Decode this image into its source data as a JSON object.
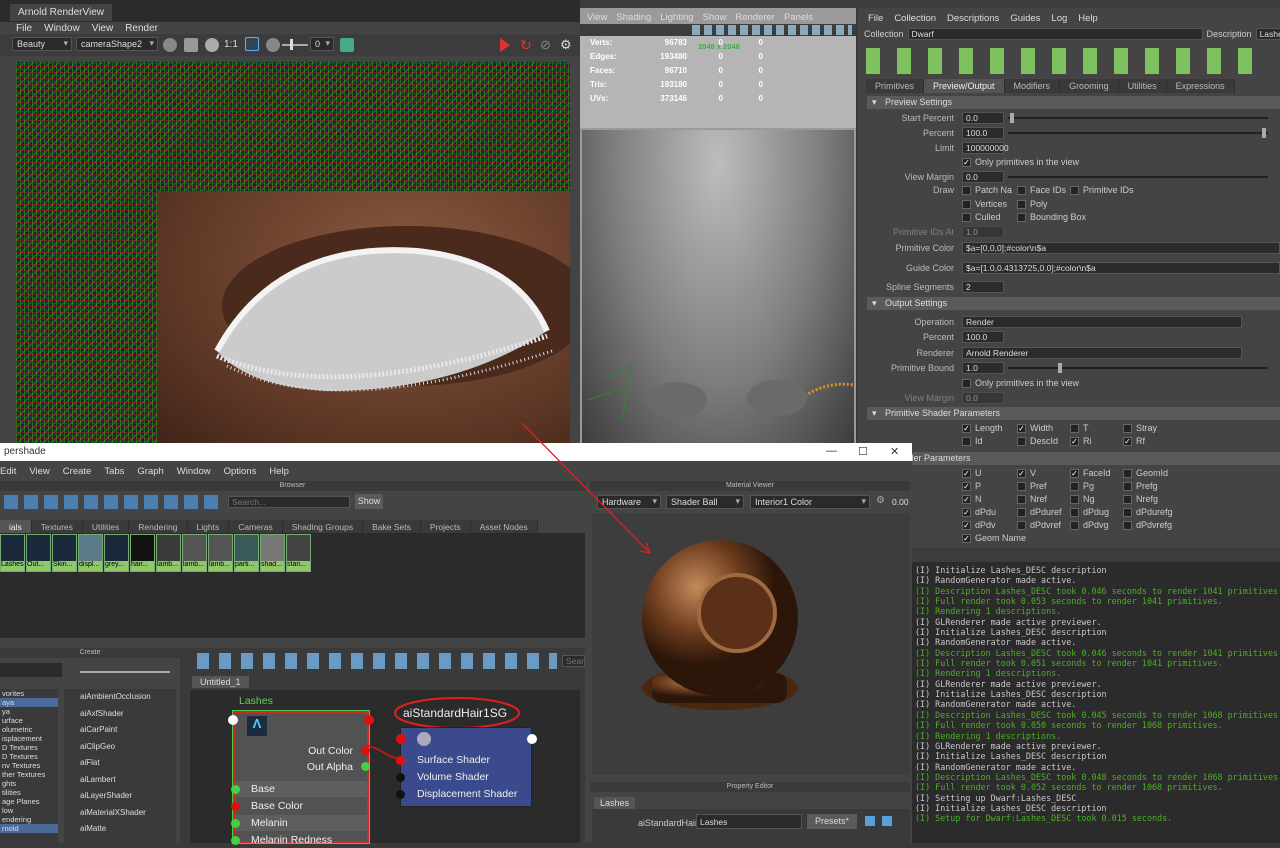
{
  "render_view": {
    "title": "Arnold RenderView",
    "menu": [
      "File",
      "Window",
      "View",
      "Render"
    ],
    "aov": "Beauty",
    "camera": "cameraShape2",
    "ratio": "1:1",
    "exposure": "0"
  },
  "viewport": {
    "menu": [
      "View",
      "Shading",
      "Lighting",
      "Show",
      "Renderer",
      "Panels"
    ],
    "hud": [
      {
        "label": "Verts:",
        "a": "96783",
        "b": "0",
        "c": "0"
      },
      {
        "label": "Edges:",
        "a": "193480",
        "b": "0",
        "c": "0"
      },
      {
        "label": "Faces:",
        "a": "96710",
        "b": "0",
        "c": "0"
      },
      {
        "label": "Tris:",
        "a": "193180",
        "b": "0",
        "c": "0"
      },
      {
        "label": "UVs:",
        "a": "373146",
        "b": "0",
        "c": "0"
      }
    ],
    "resolution": "2048 x 2048"
  },
  "xgen": {
    "menu": [
      "File",
      "Collection",
      "Descriptions",
      "Guides",
      "Log",
      "Help"
    ],
    "collection_label": "Collection",
    "collection": "Dwarf",
    "description_label": "Description",
    "description": "Lashes_DE",
    "tabs": [
      "Primitives",
      "Preview/Output",
      "Modifiers",
      "Grooming",
      "Utilities",
      "Expressions"
    ],
    "preview_header": "Preview Settings",
    "start_percent_label": "Start Percent",
    "start_percent": "0.0",
    "percent_label": "Percent",
    "percent": "100.0",
    "limit_label": "Limit",
    "limit": "100000000",
    "only_visible": "Only primitives in the view",
    "view_margin_label": "View Margin",
    "view_margin": "0.0",
    "draw_label": "Draw",
    "draw_opts": [
      "Patch Na",
      "Face IDs",
      "Primitive IDs",
      "Vertices",
      "Poly",
      "Culled",
      "Bounding Box"
    ],
    "prim_ids_at_label": "Primitive IDs At",
    "prim_ids_at": "1.0",
    "prim_color_label": "Primitive Color",
    "prim_color": "$a=[0,0,0];#color\\n$a",
    "guide_color_label": "Guide Color",
    "guide_color": "$a=[1.0,0.4313725,0.0];#color\\n$a",
    "spline_label": "Spline Segments",
    "spline": "2",
    "output_header": "Output Settings",
    "operation_label": "Operation",
    "operation": "Render",
    "out_percent_label": "Percent",
    "out_percent": "100.0",
    "renderer_label": "Renderer",
    "renderer": "Arnold Renderer",
    "prim_bound_label": "Primitive Bound",
    "prim_bound": "1.0",
    "out_only_visible": "Only primitives in the view",
    "out_view_margin_label": "View Margin",
    "out_view_margin": "0.0",
    "prim_shader_header": "Primitive Shader Parameters",
    "prim_shader": [
      "Length",
      "Width",
      "T",
      "Stray",
      "Id",
      "DescId",
      "Ri",
      "Rf"
    ],
    "shader_header": "e Shader Parameters",
    "shader_params": [
      "U",
      "V",
      "FaceId",
      "GeomId",
      "P",
      "Pref",
      "Pg",
      "Prefg",
      "N",
      "Nref",
      "Ng",
      "Nrefg",
      "dPdu",
      "dPduref",
      "dPdug",
      "dPdurefg",
      "dPdv",
      "dPdvref",
      "dPdvg",
      "dPdvrefg",
      "Geom Name"
    ]
  },
  "log": [
    {
      "t": "(I) Initialize Lashes_DESC description",
      "g": false
    },
    {
      "t": "(I) RandomGenerator made active.",
      "g": false
    },
    {
      "t": "(I) Description Lashes_DESC took 0.046 seconds to render 1041 primitives.",
      "g": true
    },
    {
      "t": "(I) Full render took 0.053 seconds to render 1041 primitives.",
      "g": true
    },
    {
      "t": "(I) Rendering 1 descriptions.",
      "g": true
    },
    {
      "t": "(I) GLRenderer made active previewer.",
      "g": false
    },
    {
      "t": "(I) Initialize Lashes_DESC description",
      "g": false
    },
    {
      "t": "(I) RandomGenerator made active.",
      "g": false
    },
    {
      "t": "(I) Description Lashes_DESC took 0.046 seconds to render 1041 primitives.",
      "g": true
    },
    {
      "t": "(I) Full render took 0.051 seconds to render 1041 primitives.",
      "g": true
    },
    {
      "t": "(I) Rendering 1 descriptions.",
      "g": true
    },
    {
      "t": "(I) GLRenderer made active previewer.",
      "g": false
    },
    {
      "t": "(I) Initialize Lashes_DESC description",
      "g": false
    },
    {
      "t": "(I) RandomGenerator made active.",
      "g": false
    },
    {
      "t": "(I) Description Lashes_DESC took 0.045 seconds to render 1068 primitives.",
      "g": true
    },
    {
      "t": "(I) Full render took 0.050 seconds to render 1068 primitives.",
      "g": true
    },
    {
      "t": "(I) Rendering 1 descriptions.",
      "g": true
    },
    {
      "t": "(I) GLRenderer made active previewer.",
      "g": false
    },
    {
      "t": "(I) Initialize Lashes_DESC description",
      "g": false
    },
    {
      "t": "(I) RandomGenerator made active.",
      "g": false
    },
    {
      "t": "(I) Description Lashes_DESC took 0.048 seconds to render 1068 primitives.",
      "g": true
    },
    {
      "t": "(I) Full render took 0.052 seconds to render 1068 primitives.",
      "g": true
    },
    {
      "t": "(I) Setting up Dwarf:Lashes_DESC",
      "g": false
    },
    {
      "t": "(I) Initialize Lashes_DESC description",
      "g": false
    },
    {
      "t": "(I) Setup for Dwarf:Lashes_DESC took 0.015 seconds.",
      "g": true
    }
  ],
  "hypershade": {
    "title": "pershade",
    "menu": [
      "Edit",
      "View",
      "Create",
      "Tabs",
      "Graph",
      "Window",
      "Options",
      "Help"
    ],
    "browser_header": "Browser",
    "search_placeholder": "Search...",
    "show": "Show",
    "browser_tabs": [
      "ials",
      "Textures",
      "Utilities",
      "Rendering",
      "Lights",
      "Cameras",
      "Shading Groups",
      "Bake Sets",
      "Projects",
      "Asset Nodes"
    ],
    "swatches": [
      "Lashes",
      "Out...",
      "Skin...",
      "displ...",
      "grey...",
      "hair...",
      "lamb...",
      "lamb...",
      "lamb...",
      "parti...",
      "shad...",
      "stan..."
    ],
    "create_header": "Create",
    "create_cats": [
      "vorites",
      "aya",
      "ya",
      "urface",
      "olumetric",
      "isplacement",
      "D Textures",
      "D Textures",
      "nv Textures",
      "ther Textures",
      "ghts",
      "tilities",
      "age Planes",
      "low",
      "endering",
      "rnold"
    ],
    "create_nodes": [
      "aiAmbientOcclusion",
      "aiAxfShader",
      "aiCarPaint",
      "aiClipGeo",
      "aiFlat",
      "aiLambert",
      "aiLayerShader",
      "aiMaterialXShader",
      "aiMatte"
    ],
    "graph_tab": "Untitled_1",
    "graph_search": "Sear",
    "node_lashes": "Lashes",
    "node_ports": [
      "Out Color",
      "Out Alpha",
      "Base",
      "Base Color",
      "Melanin",
      "Melanin Redness"
    ],
    "node_sg": "aiStandardHair1SG",
    "sg_ports": [
      "Surface Shader",
      "Volume Shader",
      "Displacement Shader"
    ],
    "mv_header": "Material Viewer",
    "mv_renderer": "Hardware",
    "mv_shape": "Shader Ball",
    "mv_env": "Interior1 Color",
    "mv_exposure": "0.00",
    "pe_header": "Property Editor",
    "pe_tab": "Lashes",
    "pe_type": "aiStandardHair",
    "pe_name": "Lashes",
    "pe_presets": "Presets*"
  },
  "colors": {
    "annotation": "#e0201c",
    "xgen_green": "#4caf28",
    "node_border": "#cc2a2a",
    "sg_node": "#3b4a8c"
  }
}
